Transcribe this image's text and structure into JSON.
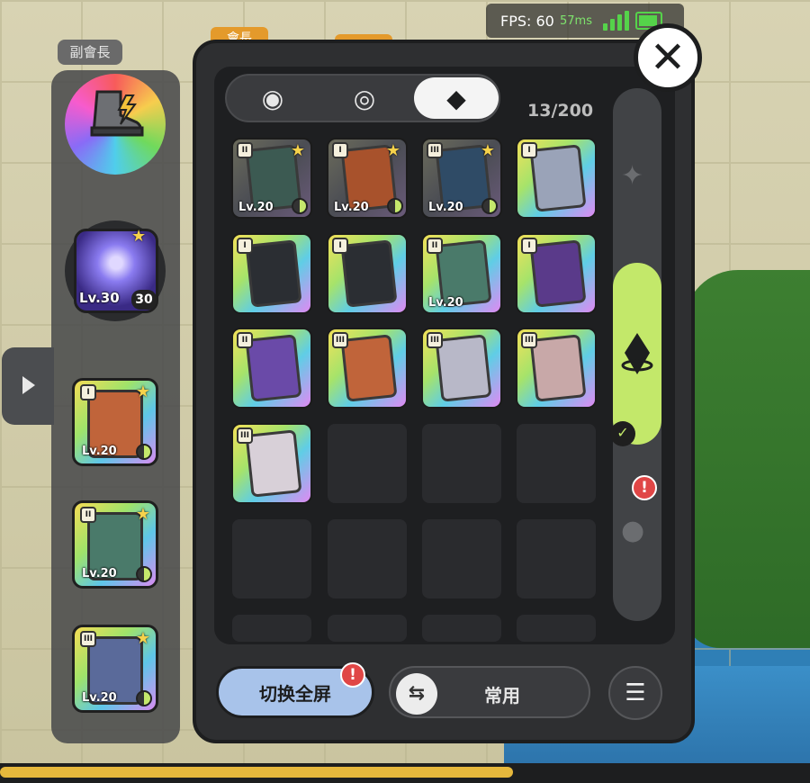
{
  "hud": {
    "fps_text": "FPS: 60",
    "ping_text": "57ms",
    "vice_leader_label": "副會長",
    "leader_label": "會長"
  },
  "left_panel": {
    "skill": {
      "level": "Lv.30",
      "count": "30"
    },
    "cards": [
      {
        "rank": "I",
        "level": "Lv.20",
        "art_color": "#c0643a",
        "progress": 0.5
      },
      {
        "rank": "II",
        "level": "Lv.20",
        "art_color": "#4a7a6a",
        "progress": 0.5
      },
      {
        "rank": "III",
        "level": "Lv.20",
        "art_color": "#5a6a9a",
        "progress": 0.5
      }
    ]
  },
  "tabs": [
    {
      "name": "tab-emblem",
      "icon": "emblem-icon",
      "glyph": "◉",
      "active": false
    },
    {
      "name": "tab-swirl",
      "icon": "swirl-icon",
      "glyph": "◎",
      "active": false
    },
    {
      "name": "tab-cards",
      "icon": "card-icon",
      "glyph": "◆",
      "active": true
    }
  ],
  "inventory": {
    "count_text": "13/200",
    "cards": [
      {
        "rank": "II",
        "level": "Lv.20",
        "dark": true,
        "star": true,
        "progress": 0.5,
        "art_color": "#3c5a52"
      },
      {
        "rank": "I",
        "level": "Lv.20",
        "dark": true,
        "star": true,
        "progress": 0.5,
        "art_color": "#a8522c"
      },
      {
        "rank": "III",
        "level": "Lv.20",
        "dark": true,
        "star": true,
        "progress": 0.5,
        "art_color": "#2f4b66"
      },
      {
        "rank": "I",
        "level": "",
        "dark": false,
        "star": false,
        "progress": null,
        "art_color": "#9aa3b8"
      },
      {
        "rank": "I",
        "level": "",
        "dark": false,
        "star": false,
        "progress": null,
        "art_color": "#2b2e33"
      },
      {
        "rank": "I",
        "level": "",
        "dark": false,
        "star": false,
        "progress": null,
        "art_color": "#2b2e33"
      },
      {
        "rank": "II",
        "level": "Lv.20",
        "dark": false,
        "star": false,
        "progress": null,
        "art_color": "#4a7a6a"
      },
      {
        "rank": "I",
        "level": "",
        "dark": false,
        "star": false,
        "progress": null,
        "art_color": "#5a3a8a"
      },
      {
        "rank": "II",
        "level": "",
        "dark": false,
        "star": false,
        "progress": null,
        "art_color": "#6a4aa8"
      },
      {
        "rank": "III",
        "level": "",
        "dark": false,
        "star": false,
        "progress": null,
        "art_color": "#c0643a"
      },
      {
        "rank": "III",
        "level": "",
        "dark": false,
        "star": false,
        "progress": null,
        "art_color": "#b8b8c8"
      },
      {
        "rank": "III",
        "level": "",
        "dark": false,
        "star": false,
        "progress": null,
        "art_color": "#c8a8a8"
      },
      {
        "rank": "III",
        "level": "",
        "dark": false,
        "star": false,
        "progress": null,
        "art_color": "#d8d0d8"
      }
    ]
  },
  "buttons": {
    "fullscreen_label": "切换全屏",
    "common_label": "常用",
    "alert_mark": "!"
  },
  "colors": {
    "panel_bg": "#2e2f31",
    "accent_green": "#c3e86a",
    "button_blue": "#a8c3ea",
    "alert_red": "#e04646"
  }
}
